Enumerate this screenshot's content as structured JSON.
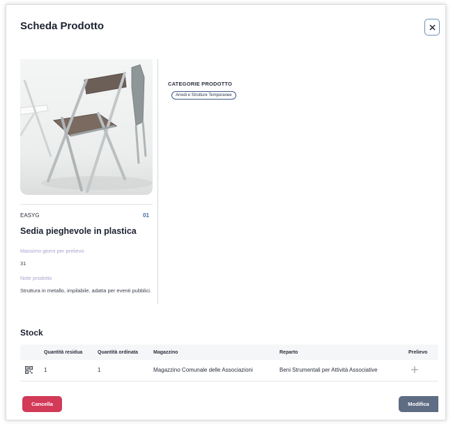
{
  "modal": {
    "title": "Scheda Prodotto",
    "close_icon": "close-icon"
  },
  "product": {
    "code": "EASYG",
    "variant": "01",
    "name": "Sedia pieghevole in plastica",
    "max_days_label": "Massimo giorni per prelievo",
    "max_days_value": "31",
    "notes_label": "Note prodotto",
    "notes_value": "Struttura in metallo, impilabile, adatta per eventi pubblici."
  },
  "categories": {
    "title": "CATEGORIE PRODOTTO",
    "items": [
      "Arredi e Strutture Temporanee"
    ]
  },
  "stock": {
    "title": "Stock",
    "columns": [
      "Quantità residua",
      "Quantità ordinata",
      "Magazzino",
      "Reparto",
      "Prelievo"
    ],
    "rows": [
      {
        "row_icon": "qr-code-icon",
        "residua": "1",
        "ordinata": "1",
        "magazzino": "Magazzino Comunale delle Associazioni",
        "reparto": "Beni Strumentali per Attività Associative",
        "action_icon": "plus-icon"
      }
    ]
  },
  "footer": {
    "cancel_label": "Cancella",
    "edit_label": "Modifica"
  },
  "colors": {
    "cancel": "#d23a57",
    "edit": "#5f6d84",
    "label_muted": "#a8a4cf",
    "accent_blue": "#3d6c9e"
  }
}
